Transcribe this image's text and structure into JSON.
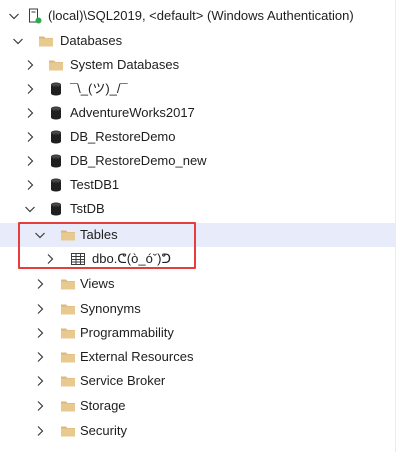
{
  "server": {
    "label": "(local)\\SQL2019, <default> (Windows Authentication)",
    "status_color": "#2fa84f"
  },
  "databases": {
    "label": "Databases"
  },
  "db_items": {
    "system_databases": "System Databases",
    "shrug": "¯\\_(ツ)_/¯",
    "adventureworks": "AdventureWorks2017",
    "restore_demo": "DB_RestoreDemo",
    "restore_demo_new": "DB_RestoreDemo_new",
    "testdb1": "TestDB1",
    "tstdb": "TstDB"
  },
  "tstdb_children": {
    "tables": "Tables",
    "table_item": "dbo.ᕦ(ò_óˇ)ᕤ",
    "views": "Views",
    "synonyms": "Synonyms",
    "programmability": "Programmability",
    "external_resources": "External Resources",
    "service_broker": "Service Broker",
    "storage": "Storage",
    "security": "Security"
  },
  "colors": {
    "folder": "#dcb67a",
    "highlight": "#e63c3c",
    "selected_bg": "#e8ebfa"
  }
}
